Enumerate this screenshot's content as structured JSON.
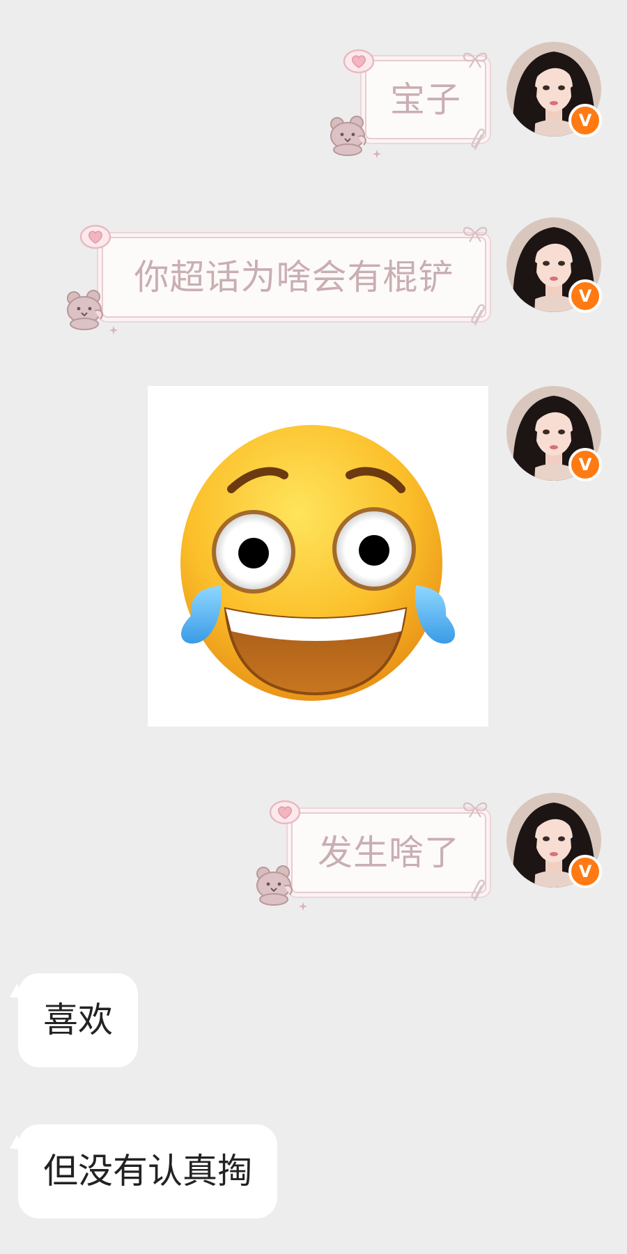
{
  "colors": {
    "background": "#ededed",
    "sent_text": "#c9aeb2",
    "received_text": "#222222",
    "verified_badge": "#ff7a12"
  },
  "avatar": {
    "icon": "user-avatar",
    "badge_icon": "verified-v-badge",
    "badge_text": "V"
  },
  "messages": [
    {
      "type": "text",
      "direction": "sent",
      "text": "宝子"
    },
    {
      "type": "text",
      "direction": "sent",
      "text": "你超话为啥会有棍铲"
    },
    {
      "type": "image",
      "direction": "sent",
      "icon": "laughing-crying-emoji"
    },
    {
      "type": "text",
      "direction": "sent",
      "text": "发生啥了"
    },
    {
      "type": "text",
      "direction": "received",
      "text": "喜欢"
    },
    {
      "type": "text",
      "direction": "received",
      "text": "但没有认真掏"
    }
  ]
}
